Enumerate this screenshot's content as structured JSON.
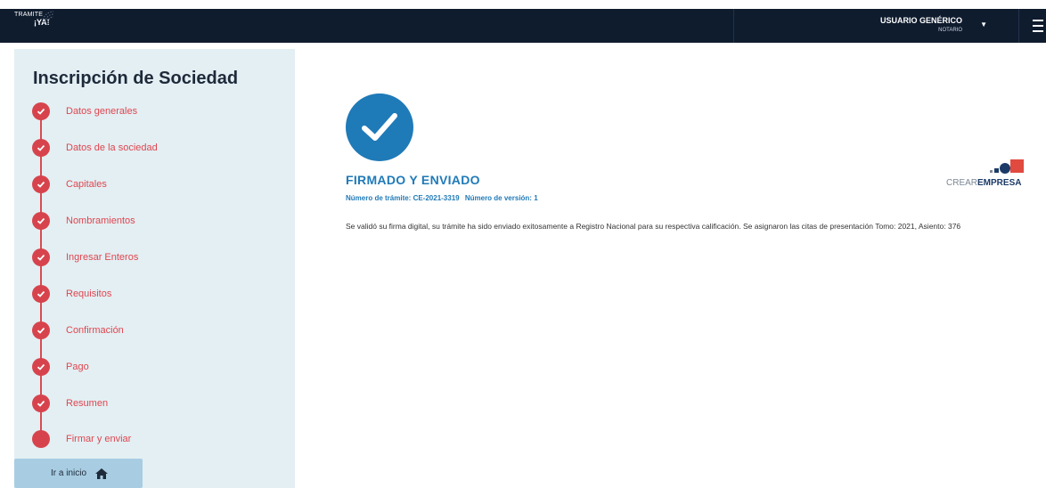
{
  "app": {
    "logo_line1": "TRAMITE",
    "logo_line2": "¡YA!"
  },
  "header": {
    "user_name": "USUARIO GENÉRICO",
    "user_role": "NOTARIO"
  },
  "sidebar": {
    "title": "Inscripción de Sociedad",
    "steps": [
      {
        "label": "Datos generales",
        "done": true
      },
      {
        "label": "Datos de la sociedad",
        "done": true
      },
      {
        "label": "Capitales",
        "done": true
      },
      {
        "label": "Nombramientos",
        "done": true
      },
      {
        "label": "Ingresar Enteros",
        "done": true
      },
      {
        "label": "Requisitos",
        "done": true
      },
      {
        "label": "Confirmación",
        "done": true
      },
      {
        "label": "Pago",
        "done": true
      },
      {
        "label": "Resumen",
        "done": true
      },
      {
        "label": "Firmar y enviar",
        "done": false
      }
    ],
    "home_button": "Ir a inicio"
  },
  "main": {
    "status_title": "FIRMADO Y ENVIADO",
    "tramite_text": "Número de trámite: CE-2021-3319",
    "version_text": "Número de versión: 1",
    "message": "Se validó su firma digital, su trámite ha sido enviado exitosamente a Registro Nacional para su respectiva calificación. Se asignaron las citas de presentación Tomo: 2021, Asiento: 376"
  },
  "brand": {
    "text_part1": "CREAR",
    "text_part2": "EMPRESA"
  },
  "colors": {
    "topbar": "#0f1c2e",
    "sidebar_bg": "#e3eff3",
    "step_red": "#d7434c",
    "accent_blue": "#1f7ab8",
    "home_button": "#a8cde2"
  }
}
